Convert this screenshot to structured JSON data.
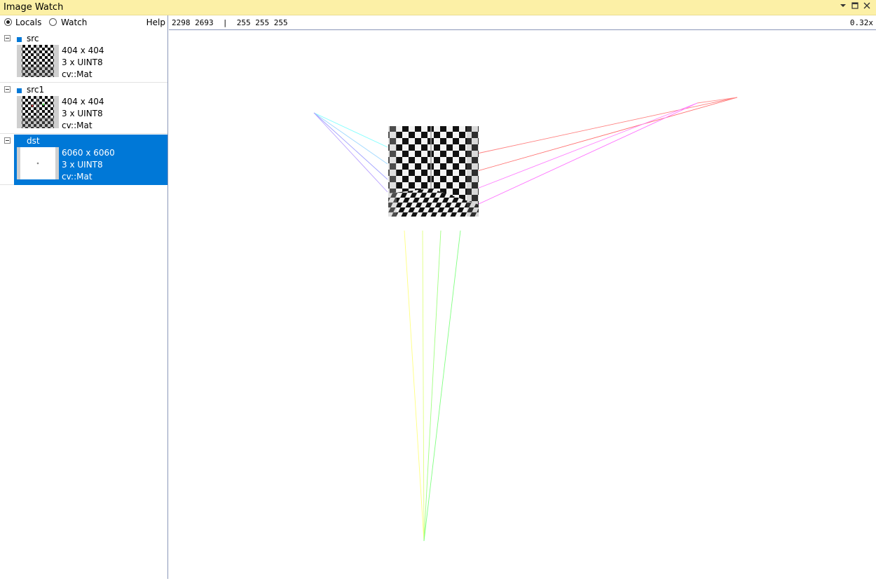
{
  "window": {
    "title": "Image Watch",
    "dropdown_icon": "chevron-down-icon",
    "maximize_icon": "maximize-icon",
    "close_icon": "close-icon"
  },
  "left_panel": {
    "locals_label": "Locals",
    "watch_label": "Watch",
    "help_label": "Help",
    "selected_mode": "Locals",
    "items": [
      {
        "name": "src",
        "size": "404 x 404",
        "channels": "3 x UINT8",
        "type": "cv::Mat",
        "selected": false
      },
      {
        "name": "src1",
        "size": "404 x 404",
        "channels": "3 x UINT8",
        "type": "cv::Mat",
        "selected": false
      },
      {
        "name": "dst",
        "size": "6060 x 6060",
        "channels": "3 x UINT8",
        "type": "cv::Mat",
        "selected": true
      }
    ]
  },
  "viewer": {
    "pixel_info": "2298 2693  |  255 255 255",
    "zoom": "0.32x"
  },
  "colors": {
    "titlebar_bg": "#fcf0a6",
    "selection": "#0078d7",
    "border": "#8b97b8"
  }
}
